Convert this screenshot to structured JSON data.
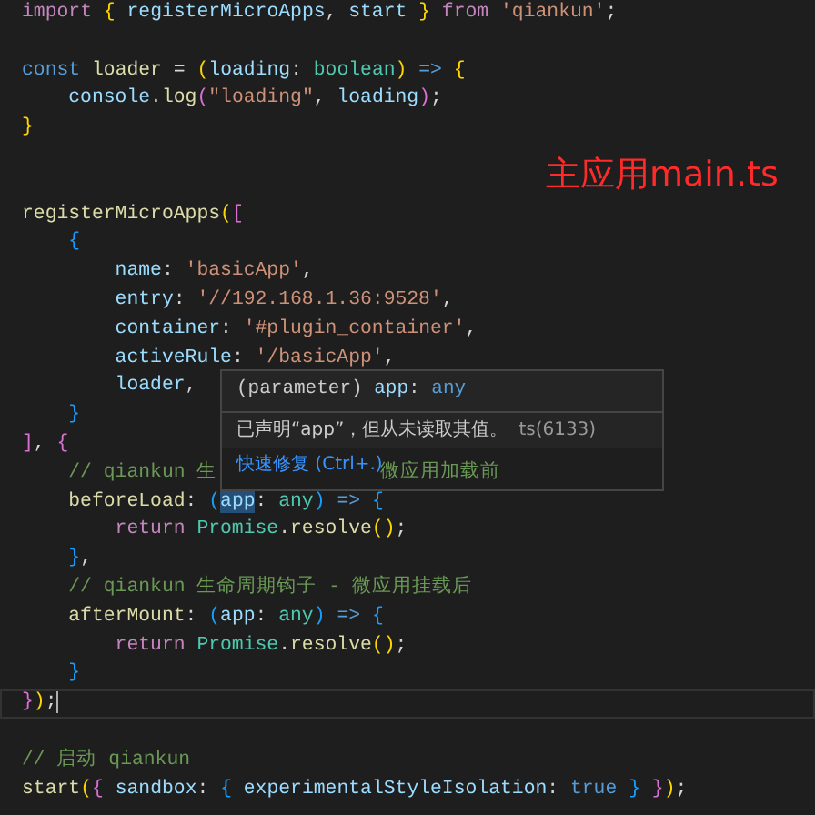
{
  "editor": {
    "lines": [
      {
        "kind": "top",
        "tokens": [
          {
            "text": "import ",
            "kind": "kw"
          },
          {
            "text": "{",
            "kind": "b1"
          },
          {
            "text": " registerMicroApps",
            "kind": "var"
          },
          {
            "text": ", ",
            "kind": "punc"
          },
          {
            "text": "start ",
            "kind": "var"
          },
          {
            "text": "}",
            "kind": "b1"
          },
          {
            "text": " from ",
            "kind": "kw"
          },
          {
            "text": "'qiankun'",
            "kind": "str"
          },
          {
            "text": ";",
            "kind": "punc"
          }
        ]
      },
      {
        "kind": "blank"
      },
      {
        "kind": "top",
        "tokens": [
          {
            "text": "const",
            "kind": "st"
          },
          {
            "text": " loader",
            "kind": "fn"
          },
          {
            "text": " = ",
            "kind": "punc"
          },
          {
            "text": "(",
            "kind": "b1"
          },
          {
            "text": "loading",
            "kind": "var"
          },
          {
            "text": ": ",
            "kind": "punc"
          },
          {
            "text": "boolean",
            "kind": "type"
          },
          {
            "text": ")",
            "kind": "b1"
          },
          {
            "text": " => ",
            "kind": "st"
          },
          {
            "text": "{",
            "kind": "b1"
          }
        ]
      },
      {
        "kind": "nested",
        "tokens": [
          {
            "text": "console",
            "kind": "var"
          },
          {
            "text": ".",
            "kind": "punc"
          },
          {
            "text": "log",
            "kind": "fn"
          },
          {
            "text": "(",
            "kind": "b2"
          },
          {
            "text": "\"loading\"",
            "kind": "str"
          },
          {
            "text": ", ",
            "kind": "punc"
          },
          {
            "text": "loading",
            "kind": "var"
          },
          {
            "text": ")",
            "kind": "b2"
          },
          {
            "text": ";",
            "kind": "punc"
          }
        ]
      },
      {
        "kind": "top",
        "tokens": [
          {
            "text": "}",
            "kind": "b1"
          }
        ]
      },
      {
        "kind": "blank"
      },
      {
        "kind": "blank"
      },
      {
        "kind": "top",
        "tokens": [
          {
            "text": "registerMicroApps",
            "kind": "fn"
          },
          {
            "text": "(",
            "kind": "b1"
          },
          {
            "text": "[",
            "kind": "b2"
          }
        ]
      },
      {
        "kind": "nested",
        "tokens": [
          {
            "text": "{",
            "kind": "b3"
          }
        ]
      },
      {
        "kind": "deep",
        "tokens": [
          {
            "text": "name",
            "kind": "var"
          },
          {
            "text": ": ",
            "kind": "punc"
          },
          {
            "text": "'basicApp'",
            "kind": "str"
          },
          {
            "text": ",",
            "kind": "punc"
          }
        ]
      },
      {
        "kind": "deep",
        "tokens": [
          {
            "text": "entry",
            "kind": "var"
          },
          {
            "text": ": ",
            "kind": "punc"
          },
          {
            "text": "'//192.168.1.36:9528'",
            "kind": "str"
          },
          {
            "text": ",",
            "kind": "punc"
          }
        ]
      },
      {
        "kind": "deep",
        "tokens": [
          {
            "text": "container",
            "kind": "var"
          },
          {
            "text": ": ",
            "kind": "punc"
          },
          {
            "text": "'#plugin_container'",
            "kind": "str"
          },
          {
            "text": ",",
            "kind": "punc"
          }
        ]
      },
      {
        "kind": "deep",
        "tokens": [
          {
            "text": "activeRule",
            "kind": "var"
          },
          {
            "text": ": ",
            "kind": "punc"
          },
          {
            "text": "'/basicApp'",
            "kind": "str"
          },
          {
            "text": ",",
            "kind": "punc"
          }
        ]
      },
      {
        "kind": "deep",
        "tokens": [
          {
            "text": "loader",
            "kind": "var"
          },
          {
            "text": ",",
            "kind": "punc"
          }
        ]
      },
      {
        "kind": "nested",
        "tokens": [
          {
            "text": "}",
            "kind": "b3"
          }
        ]
      },
      {
        "kind": "top",
        "tokens": [
          {
            "text": "]",
            "kind": "b2"
          },
          {
            "text": ", ",
            "kind": "punc"
          },
          {
            "text": "{",
            "kind": "b2"
          }
        ]
      },
      {
        "kind": "nested",
        "tokens": [
          {
            "text": "// qiankun 生",
            "kind": "cmt"
          }
        ],
        "tail": "微应用加载前"
      },
      {
        "kind": "nested",
        "tokens": [
          {
            "text": "beforeLoad",
            "kind": "fn"
          },
          {
            "text": ": ",
            "kind": "punc"
          },
          {
            "text": "(",
            "kind": "b3"
          },
          {
            "text": "app",
            "kind": "hover"
          },
          {
            "text": ": ",
            "kind": "punc"
          },
          {
            "text": "any",
            "kind": "type"
          },
          {
            "text": ")",
            "kind": "b3"
          },
          {
            "text": " => ",
            "kind": "st"
          },
          {
            "text": "{",
            "kind": "b3"
          }
        ]
      },
      {
        "kind": "deep",
        "tokens": [
          {
            "text": "return",
            "kind": "kw"
          },
          {
            "text": " Promise",
            "kind": "type"
          },
          {
            "text": ".",
            "kind": "punc"
          },
          {
            "text": "resolve",
            "kind": "fn"
          },
          {
            "text": "()",
            "kind": "b1"
          },
          {
            "text": ";",
            "kind": "punc"
          }
        ]
      },
      {
        "kind": "nested",
        "tokens": [
          {
            "text": "}",
            "kind": "b3"
          },
          {
            "text": ",",
            "kind": "punc"
          }
        ]
      },
      {
        "kind": "nested",
        "tokens": [
          {
            "text": "// qiankun 生命周期钩子 - 微应用挂载后",
            "kind": "cmt"
          }
        ]
      },
      {
        "kind": "nested",
        "tokens": [
          {
            "text": "afterMount",
            "kind": "fn"
          },
          {
            "text": ": ",
            "kind": "punc"
          },
          {
            "text": "(",
            "kind": "b3"
          },
          {
            "text": "app",
            "kind": "var"
          },
          {
            "text": ": ",
            "kind": "punc"
          },
          {
            "text": "any",
            "kind": "type"
          },
          {
            "text": ")",
            "kind": "b3"
          },
          {
            "text": " => ",
            "kind": "st"
          },
          {
            "text": "{",
            "kind": "b3"
          }
        ]
      },
      {
        "kind": "deep",
        "tokens": [
          {
            "text": "return",
            "kind": "kw"
          },
          {
            "text": " Promise",
            "kind": "type"
          },
          {
            "text": ".",
            "kind": "punc"
          },
          {
            "text": "resolve",
            "kind": "fn"
          },
          {
            "text": "()",
            "kind": "b1"
          },
          {
            "text": ";",
            "kind": "punc"
          }
        ]
      },
      {
        "kind": "nested",
        "tokens": [
          {
            "text": "}",
            "kind": "b3"
          }
        ]
      },
      {
        "kind": "top",
        "current": true,
        "tokens": [
          {
            "text": "}",
            "kind": "b2"
          },
          {
            "text": ")",
            "kind": "b1"
          },
          {
            "text": ";",
            "kind": "punc"
          }
        ]
      },
      {
        "kind": "blank"
      },
      {
        "kind": "top",
        "tokens": [
          {
            "text": "// 启动 qiankun",
            "kind": "cmt"
          }
        ]
      },
      {
        "kind": "top",
        "tokens": [
          {
            "text": "start",
            "kind": "fn"
          },
          {
            "text": "(",
            "kind": "b1"
          },
          {
            "text": "{",
            "kind": "b2"
          },
          {
            "text": " sandbox",
            "kind": "var"
          },
          {
            "text": ": ",
            "kind": "punc"
          },
          {
            "text": "{",
            "kind": "b3"
          },
          {
            "text": " experimentalStyleIsolation",
            "kind": "var"
          },
          {
            "text": ": ",
            "kind": "punc"
          },
          {
            "text": "true ",
            "kind": "st"
          },
          {
            "text": "}",
            "kind": "b3"
          },
          {
            "text": " }",
            "kind": "b2"
          },
          {
            "text": ")",
            "kind": "b1"
          },
          {
            "text": ";",
            "kind": "punc"
          }
        ]
      }
    ]
  },
  "annotation": "主应用main.ts",
  "hover_tooltip": {
    "signature": [
      {
        "text": "(parameter) ",
        "kind": "sig"
      },
      {
        "text": "app",
        "kind": "var"
      },
      {
        "text": ": ",
        "kind": "sig"
      },
      {
        "text": "any",
        "kind": "st"
      }
    ],
    "message": "已声明“app”，但从未读取其值。",
    "code": "ts(6133)",
    "action": "快速修复 (Ctrl+.)"
  }
}
